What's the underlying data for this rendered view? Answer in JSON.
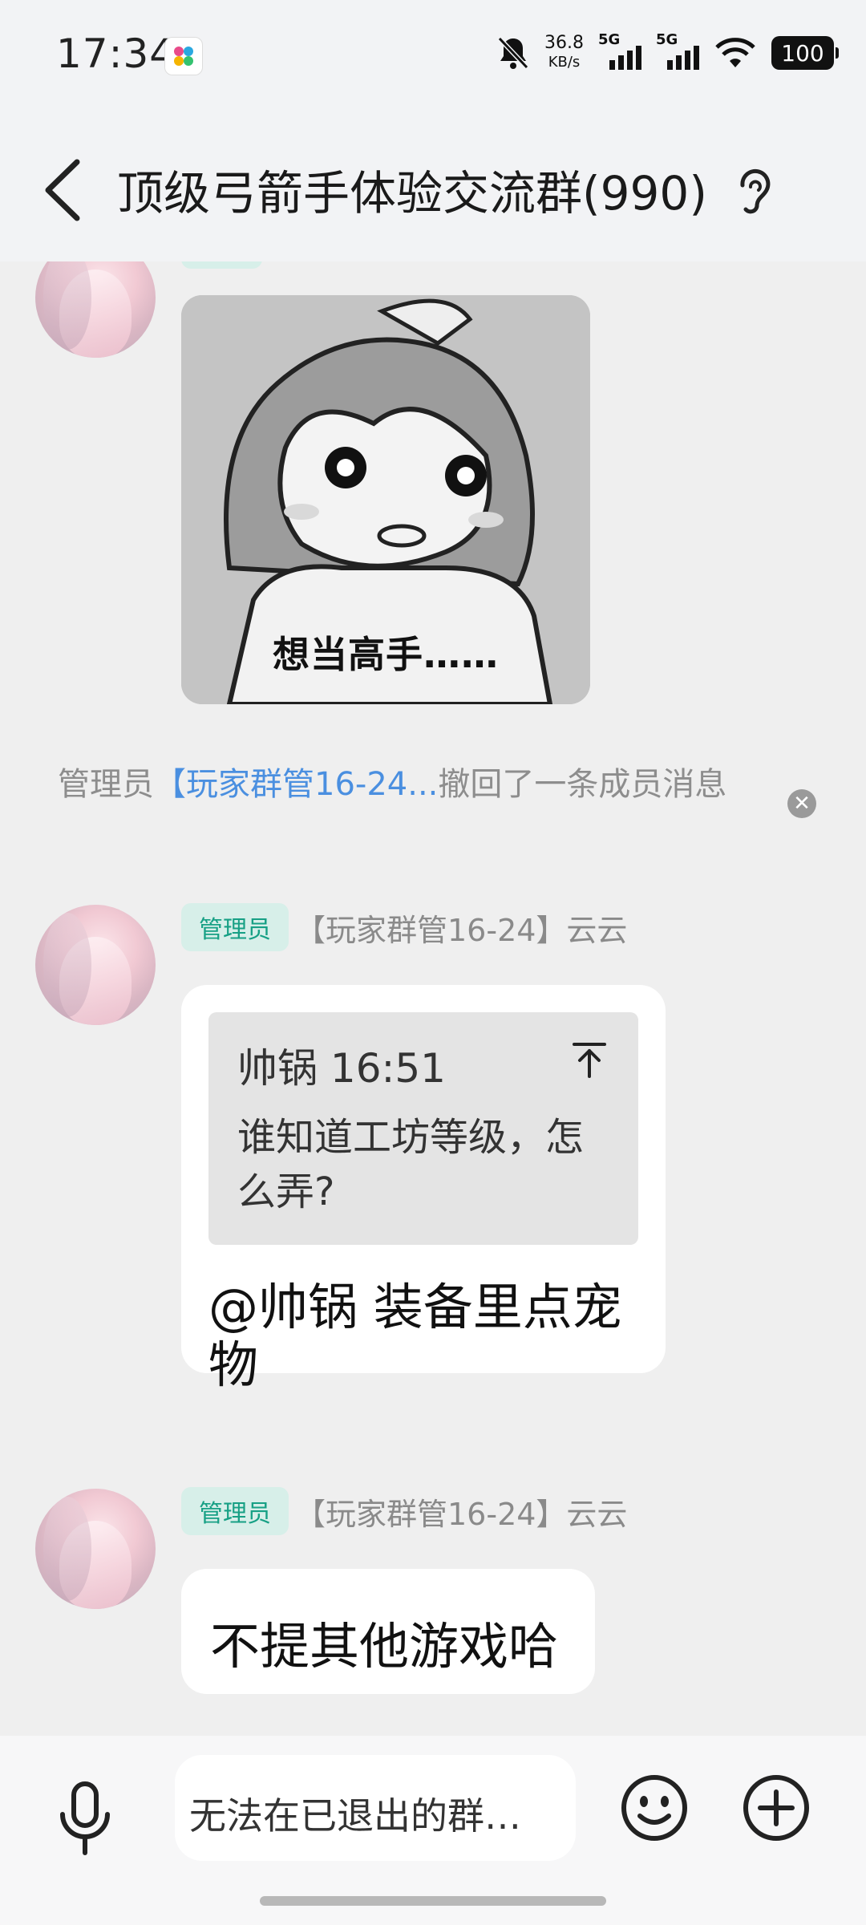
{
  "status_bar": {
    "time": "17:34",
    "net_speed_value": "36.8",
    "net_speed_unit": "KB/s",
    "sim1": "5G",
    "sim2": "5G",
    "battery": "100"
  },
  "header": {
    "title": "顶级弓箭手体验交流群(990)"
  },
  "messages": {
    "sticker": {
      "caption": "想当高手……"
    },
    "system": {
      "prefix": "管理员",
      "link": "【玩家群管16-24...",
      "suffix": "撤回了一条成员消息"
    },
    "reply_message": {
      "role": "管理员",
      "sender": "【玩家群管16-24】云云",
      "quote_header": "帅锅 16:51",
      "quote_text": "谁知道工坊等级，怎么弄?",
      "text": "@帅锅 装备里点宠物"
    },
    "last_message": {
      "role": "管理员",
      "sender": "【玩家群管16-24】云云",
      "text": "不提其他游戏哈"
    }
  },
  "input": {
    "placeholder": "无法在已退出的群…"
  },
  "colors": {
    "badge_bg": "#d7efe9",
    "badge_text": "#17a085",
    "link": "#4a8fe0",
    "chat_bg": "#efefef"
  }
}
